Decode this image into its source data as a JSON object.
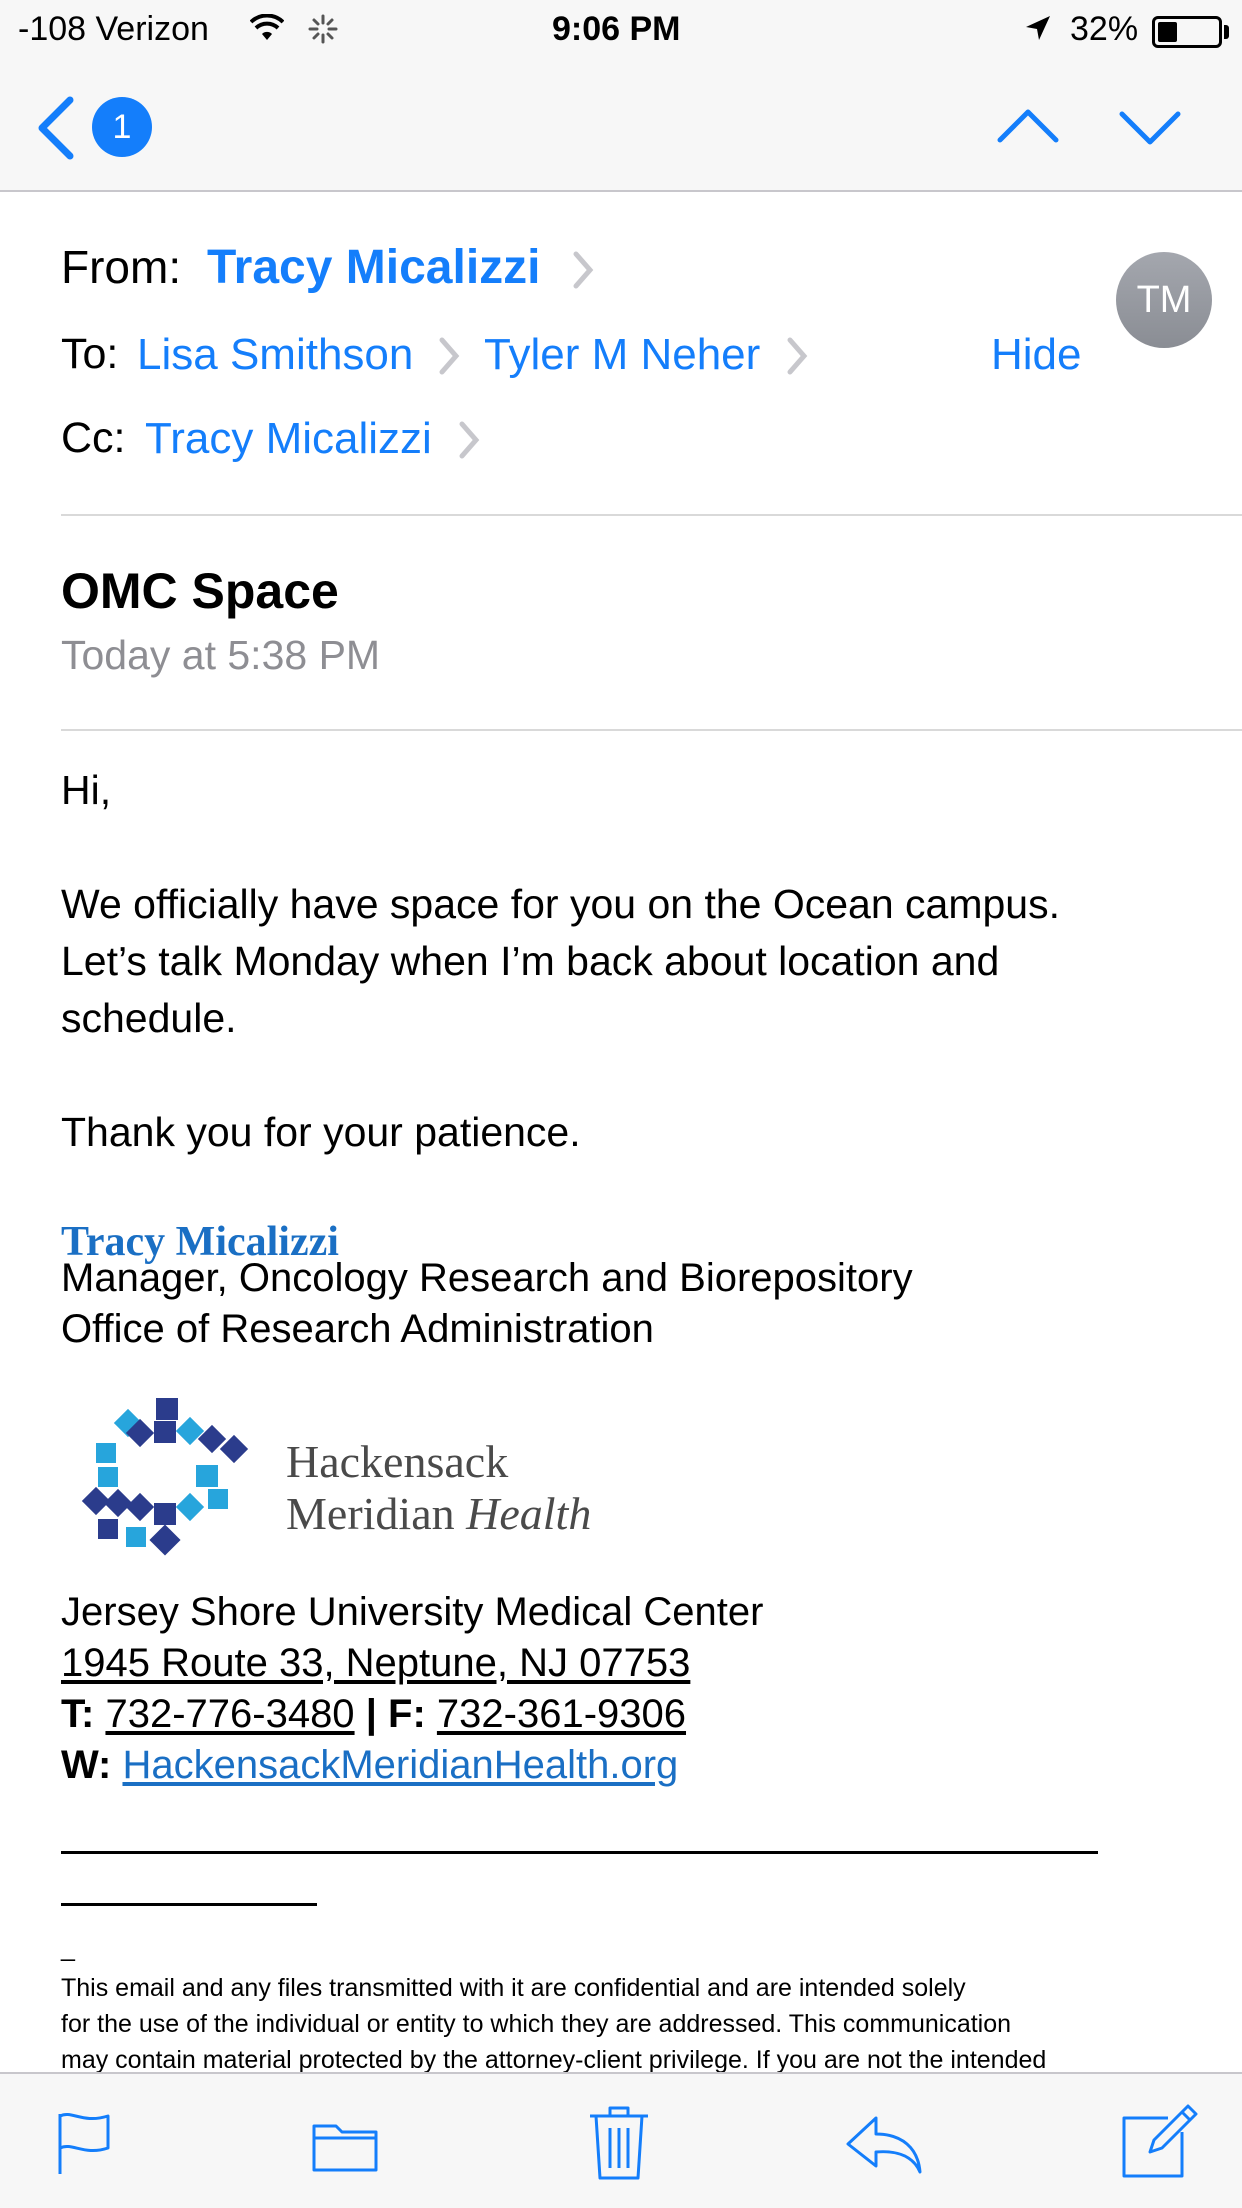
{
  "status_bar": {
    "carrier": "-108 Verizon",
    "time": "9:06 PM",
    "battery": "32%",
    "battery_level": 0.32
  },
  "nav": {
    "back_badge": "1",
    "icons": [
      "back-chevron-icon",
      "up-arrow-icon",
      "down-arrow-icon"
    ]
  },
  "header": {
    "from_label": "From:",
    "from_name": "Tracy Micalizzi",
    "to_label": "To:",
    "to_names": [
      "Lisa Smithson",
      "Tyler M Neher"
    ],
    "hide_label": "Hide",
    "cc_label": "Cc:",
    "cc_name": "Tracy Micalizzi",
    "avatar_initials": "TM"
  },
  "message": {
    "subject": "OMC Space",
    "date": "Today at 5:38 PM",
    "greeting": "Hi,",
    "paragraph1": [
      "We officially have space for you on the Ocean campus.",
      "Let’s talk Monday when I’m back about location and",
      "schedule."
    ],
    "paragraph2": "Thank you for your patience."
  },
  "signature": {
    "name": "Tracy Micalizzi",
    "title": "Manager, Oncology Research and Biorepository",
    "office": "Office of Research Administration",
    "logo_line1": "Hackensack",
    "logo_line2_a": "Meridian",
    "logo_line2_b": "Health",
    "facility": "Jersey Shore University Medical Center",
    "address": "1945 Route 33, Neptune, NJ 07753",
    "t_label": "T:",
    "phone": "732-776-3480",
    "sep": "|",
    "f_label": "F:",
    "fax": "732-361-9306",
    "w_label": "W:",
    "website": "HackensackMeridianHealth.org",
    "dash": "_"
  },
  "disclaimer": [
    "This email and any files transmitted with it are confidential and are intended solely",
    "for the use of the individual or entity to which they are addressed. This communication",
    "may contain material protected by the attorney-client privilege. If you are not the intended"
  ],
  "toolbar": {
    "icons": [
      "flag-icon",
      "folder-icon",
      "trash-icon",
      "reply-icon",
      "compose-icon"
    ]
  },
  "colors": {
    "accent": "#147efb",
    "signature_name": "#1a6fc4",
    "logo_dark": "#2b3c8c",
    "logo_light": "#27a5dc"
  }
}
